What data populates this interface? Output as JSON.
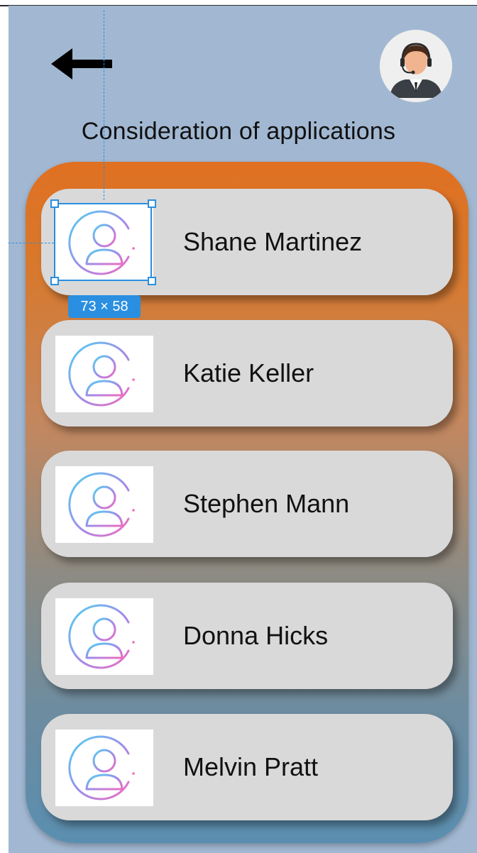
{
  "header": {
    "title": "Consideration of applications",
    "back_icon": "arrow-left-icon",
    "avatar_icon": "support-agent-icon"
  },
  "applicants": [
    {
      "name": "Shane Martinez",
      "icon": "user-circle-icon"
    },
    {
      "name": "Katie Keller",
      "icon": "user-circle-icon"
    },
    {
      "name": "Stephen Mann",
      "icon": "user-circle-icon"
    },
    {
      "name": "Donna Hicks",
      "icon": "user-circle-icon"
    },
    {
      "name": "Melvin Pratt",
      "icon": "user-circle-icon"
    }
  ],
  "selection": {
    "dimensions_label": "73 × 58"
  },
  "colors": {
    "background": "#a2b8d2",
    "panel_top": "#e07022",
    "panel_bottom": "#5a8eb0",
    "card": "#d9d9d9",
    "selection": "#2a8fe0"
  }
}
